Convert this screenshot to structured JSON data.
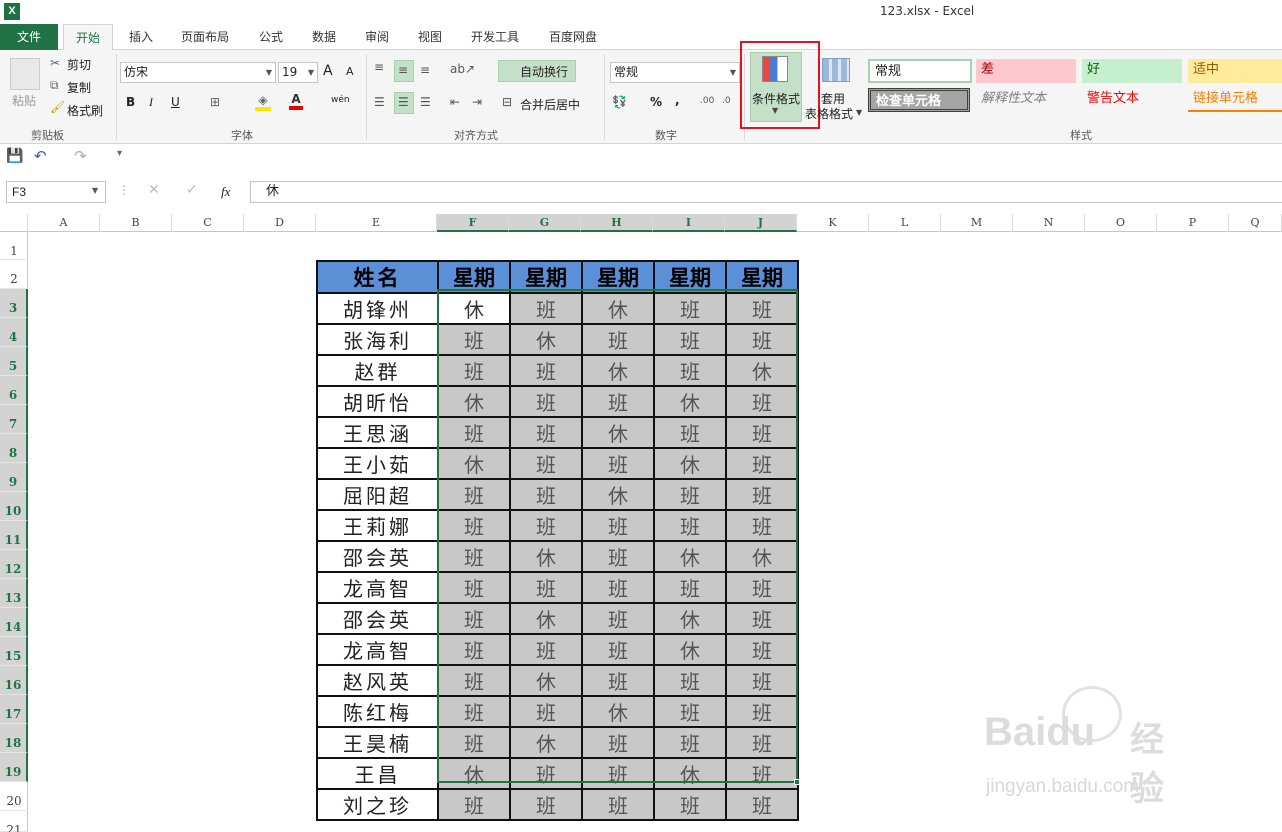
{
  "window": {
    "title": "123.xlsx - Excel",
    "app_icon_letter": "X"
  },
  "tabs": [
    "文件",
    "开始",
    "插入",
    "页面布局",
    "公式",
    "数据",
    "审阅",
    "视图",
    "开发工具",
    "百度网盘"
  ],
  "ribbon": {
    "clipboard": {
      "paste": "粘贴",
      "cut": "剪切",
      "copy": "复制",
      "format_painter": "格式刷",
      "label": "剪贴板"
    },
    "font": {
      "name": "仿宋",
      "size": "19",
      "bold": "B",
      "italic": "I",
      "underline": "U",
      "label": "字体",
      "grow": "A",
      "shrink": "A",
      "phonetic": "wén"
    },
    "alignment": {
      "wrap": "自动换行",
      "merge": "合并后居中",
      "label": "对齐方式"
    },
    "number": {
      "format": "常规",
      "percent": "%",
      "comma": ",",
      "label": "数字"
    },
    "conditional_format": "条件格式",
    "table_format_line1": "套用",
    "table_format_line2": "表格格式",
    "styles": {
      "label": "样式",
      "cells": [
        "常规",
        "差",
        "好",
        "适中",
        "检查单元格",
        "解释性文本",
        "警告文本",
        "链接单元格"
      ]
    }
  },
  "formula_bar": {
    "name_box": "F3",
    "fx": "fx",
    "value": "休"
  },
  "columns": [
    "A",
    "B",
    "C",
    "D",
    "E",
    "F",
    "G",
    "H",
    "I",
    "J",
    "K",
    "L",
    "M",
    "N",
    "O",
    "P",
    "Q"
  ],
  "rows": [
    "1",
    "2",
    "3",
    "4",
    "5",
    "6",
    "7",
    "8",
    "9",
    "10",
    "11",
    "12",
    "13",
    "14",
    "15",
    "16",
    "17",
    "18",
    "19",
    "20",
    "21"
  ],
  "table": {
    "header": [
      "姓名",
      "星期",
      "星期",
      "星期",
      "星期",
      "星期"
    ],
    "rows": [
      [
        "胡锋州",
        "休",
        "班",
        "休",
        "班",
        "班"
      ],
      [
        "张海利",
        "班",
        "休",
        "班",
        "班",
        "班"
      ],
      [
        "赵群",
        "班",
        "班",
        "休",
        "班",
        "休"
      ],
      [
        "胡昕怡",
        "休",
        "班",
        "班",
        "休",
        "班"
      ],
      [
        "王思涵",
        "班",
        "班",
        "休",
        "班",
        "班"
      ],
      [
        "王小茹",
        "休",
        "班",
        "班",
        "休",
        "班"
      ],
      [
        "屈阳超",
        "班",
        "班",
        "休",
        "班",
        "班"
      ],
      [
        "王莉娜",
        "班",
        "班",
        "班",
        "班",
        "班"
      ],
      [
        "邵会英",
        "班",
        "休",
        "班",
        "休",
        "休"
      ],
      [
        "龙高智",
        "班",
        "班",
        "班",
        "班",
        "班"
      ],
      [
        "邵会英",
        "班",
        "休",
        "班",
        "休",
        "班"
      ],
      [
        "龙高智",
        "班",
        "班",
        "班",
        "休",
        "班"
      ],
      [
        "赵风英",
        "班",
        "休",
        "班",
        "班",
        "班"
      ],
      [
        "陈红梅",
        "班",
        "班",
        "休",
        "班",
        "班"
      ],
      [
        "王昊楠",
        "班",
        "休",
        "班",
        "班",
        "班"
      ],
      [
        "王昌",
        "休",
        "班",
        "班",
        "休",
        "班"
      ],
      [
        "刘之珍",
        "班",
        "班",
        "班",
        "班",
        "班"
      ]
    ]
  },
  "watermark": {
    "brand": "Baidu",
    "cn": "经验",
    "url": "jingyan.baidu.com"
  },
  "colors": {
    "excel_green": "#217346",
    "header_blue": "#5b8fd6",
    "shade_gray": "#c8c8c8",
    "highlight_red": "#e81123"
  }
}
